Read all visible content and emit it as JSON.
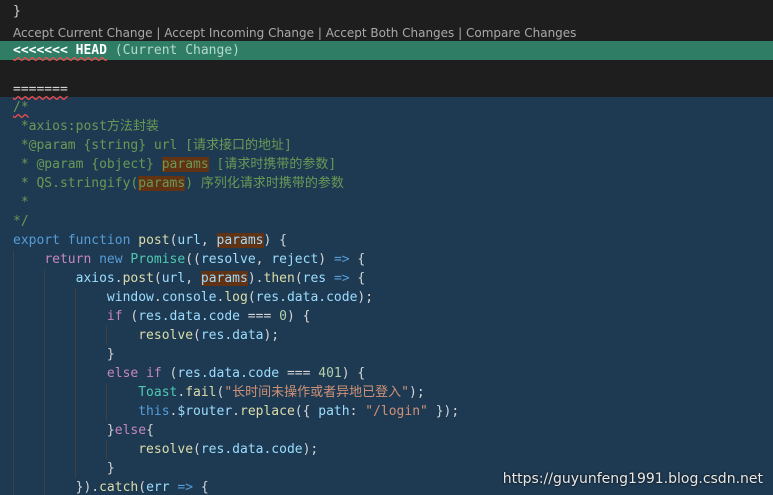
{
  "editor": {
    "closing_brace": "}",
    "codelens": {
      "accept_current": "Accept Current Change",
      "accept_incoming": "Accept Incoming Change",
      "accept_both": "Accept Both Changes",
      "compare": "Compare Changes",
      "separator": " | "
    },
    "conflict": {
      "head_marker": "<<<<<<< HEAD",
      "head_label": "(Current Change)",
      "separator_marker": "======="
    },
    "code": {
      "l1": "/*",
      "l2": " *axios:post方法封装",
      "l3a": " *@param {string} url [请求接口的地址]",
      "l4a": " * @param {object} ",
      "l4b": "params",
      "l4c": " [请求时携带的参数]",
      "l5a": " * QS.stringify(",
      "l5b": "params",
      "l5c": ") 序列化请求时携带的参数",
      "l6": " *",
      "l7": "*/",
      "kw_export": "export",
      "kw_function": "function",
      "fn_post": "post",
      "p_url": "url",
      "p_params": "params",
      "kw_return": "return",
      "kw_new": "new",
      "cls_promise": "Promise",
      "p_resolve": "resolve",
      "p_reject": "reject",
      "arrow": "=>",
      "obj_axios": "axios",
      "fn_then": "then",
      "p_res": "res",
      "obj_window": "window",
      "obj_console": "console",
      "fn_log": "log",
      "res_data_code": "res.data.code",
      "res_data": "res.data",
      "kw_if": "if",
      "kw_else": "else",
      "num_0": "0",
      "num_401": "401",
      "obj_toast": "Toast",
      "fn_fail": "fail",
      "str_fail": "\"长时间未操作或者异地已登入\"",
      "kw_this": "this",
      "obj_router": "$router",
      "fn_replace": "replace",
      "key_path": "path",
      "str_login": "\"/login\"",
      "fn_catch": "catch",
      "p_err": "err"
    }
  },
  "watermark": "https://guyunfeng1991.blog.csdn.net"
}
